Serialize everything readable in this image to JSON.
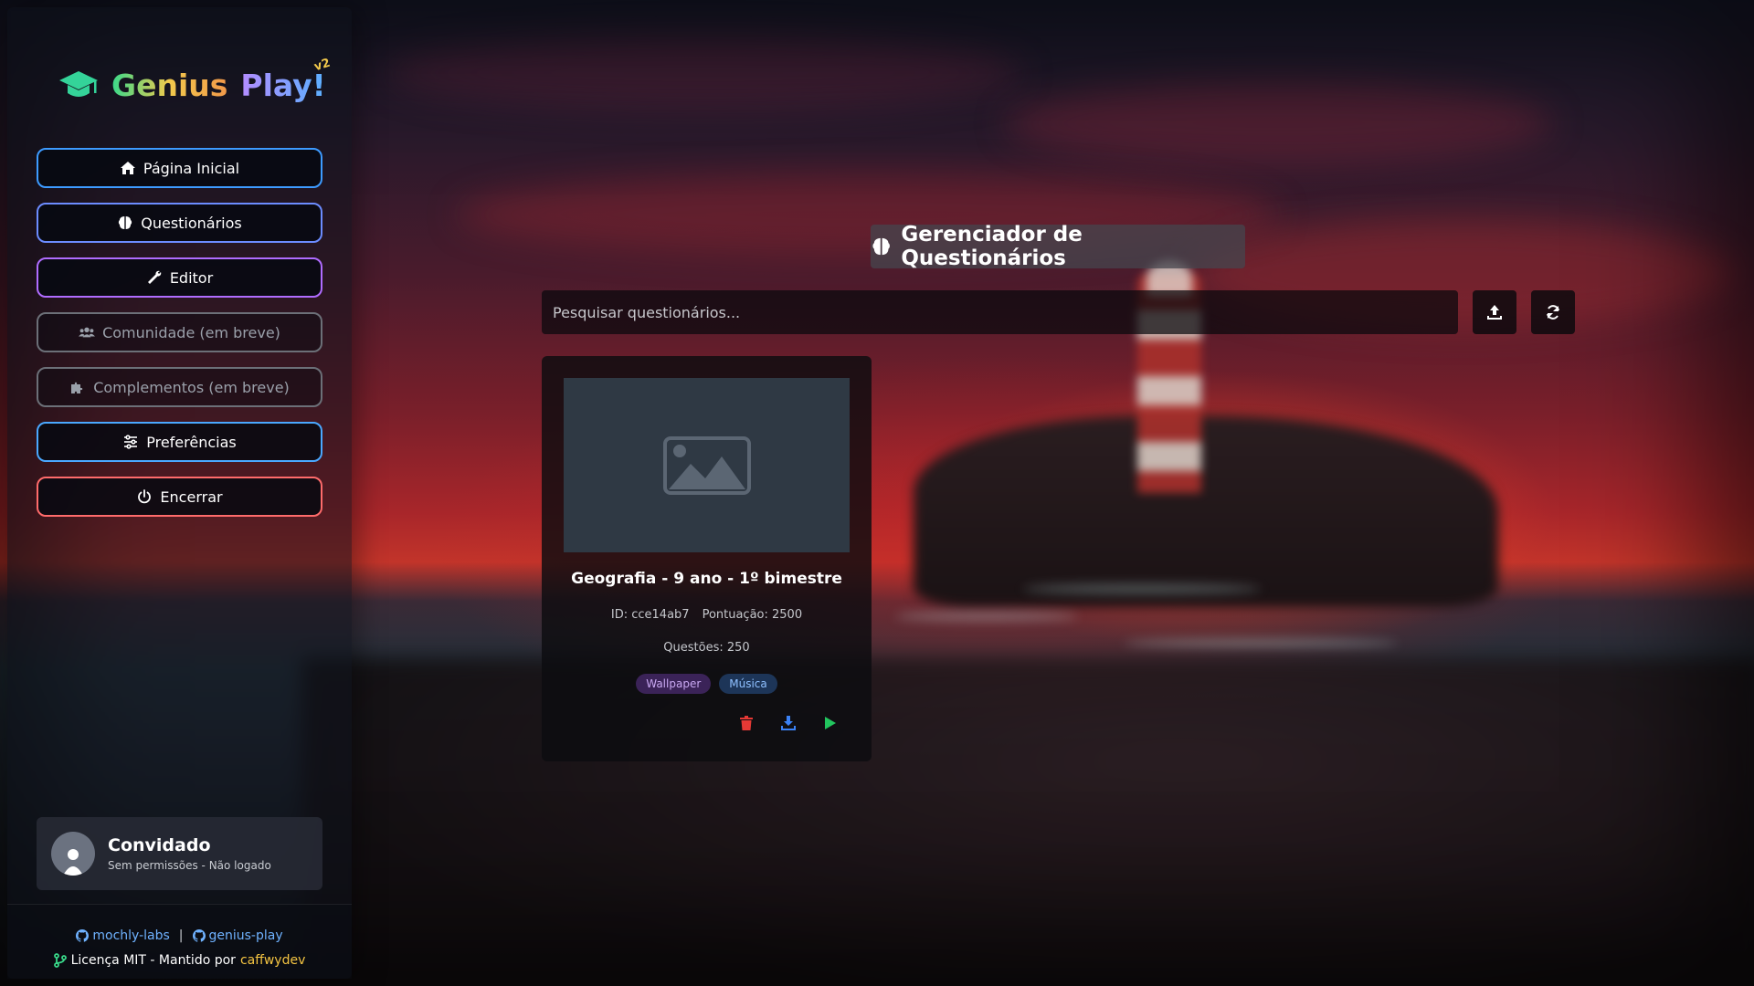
{
  "app": {
    "logo_word1": "Genius",
    "logo_word2": "Play!",
    "logo_version": "v2"
  },
  "sidebar": {
    "items": [
      {
        "label": "Página Inicial",
        "icon": "home-icon",
        "enabled": true
      },
      {
        "label": "Questionários",
        "icon": "brain-icon",
        "enabled": true
      },
      {
        "label": "Editor",
        "icon": "wrench-icon",
        "enabled": true
      },
      {
        "label": "Comunidade (em breve)",
        "icon": "users-icon",
        "enabled": false
      },
      {
        "label": "Complementos (em breve)",
        "icon": "puzzle-icon",
        "enabled": false
      },
      {
        "label": "Preferências",
        "icon": "sliders-icon",
        "enabled": true
      },
      {
        "label": "Encerrar",
        "icon": "power-icon",
        "enabled": true
      }
    ]
  },
  "user": {
    "name": "Convidado",
    "status": "Sem permissões - Não logado"
  },
  "footer": {
    "link1": "mochly-labs",
    "separator": "|",
    "link2": "genius-play",
    "license": "Licença MIT - Mantido por",
    "maintainer": "caffwydev"
  },
  "main": {
    "title": "Gerenciador de Questionários",
    "search_placeholder": "Pesquisar questionários...",
    "search_value": ""
  },
  "quizzes": [
    {
      "title": "Geografia - 9 ano - 1º bimestre",
      "id_text": "ID: cce14ab7",
      "score_text": "Pontuação: 2500",
      "questions_text": "Questões: 250",
      "tags": [
        "Wallpaper",
        "Música"
      ]
    }
  ],
  "colors": {
    "accent_blue": "#3d9bff",
    "accent_purple": "#b06cff",
    "danger": "#ff6b6b",
    "delete_icon": "#e53935",
    "download_icon": "#3b82f6",
    "play_icon": "#22c55e",
    "maintainer": "#f5c542"
  }
}
